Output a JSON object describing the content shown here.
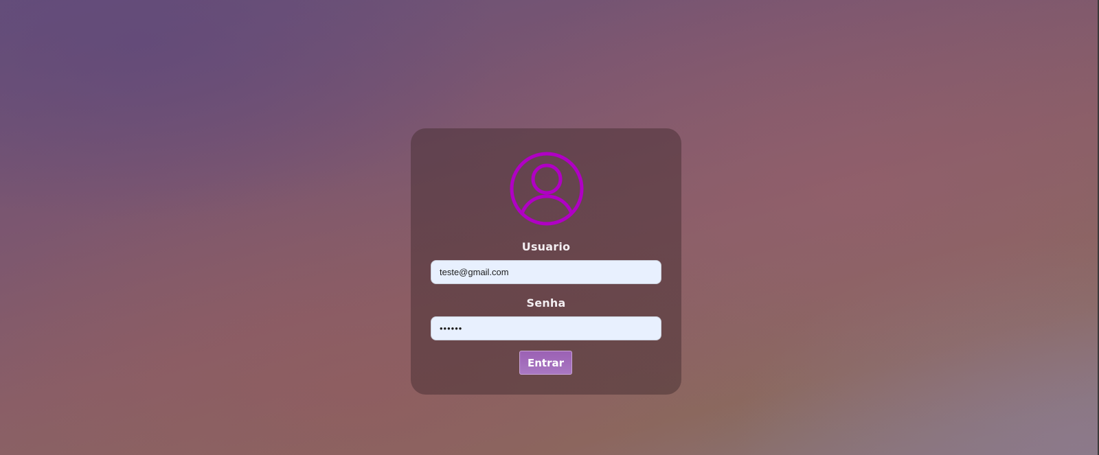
{
  "login": {
    "user_label": "Usuario",
    "user_value": "teste@gmail.com",
    "password_label": "Senha",
    "password_value": "••••••",
    "submit_label": "Entrar"
  },
  "icons": {
    "avatar": "user-circle-icon"
  },
  "colors": {
    "accent": "#b000c4",
    "button": "#9b61b4",
    "input_bg": "#e8f0fe",
    "card_bg": "#5f4048"
  }
}
